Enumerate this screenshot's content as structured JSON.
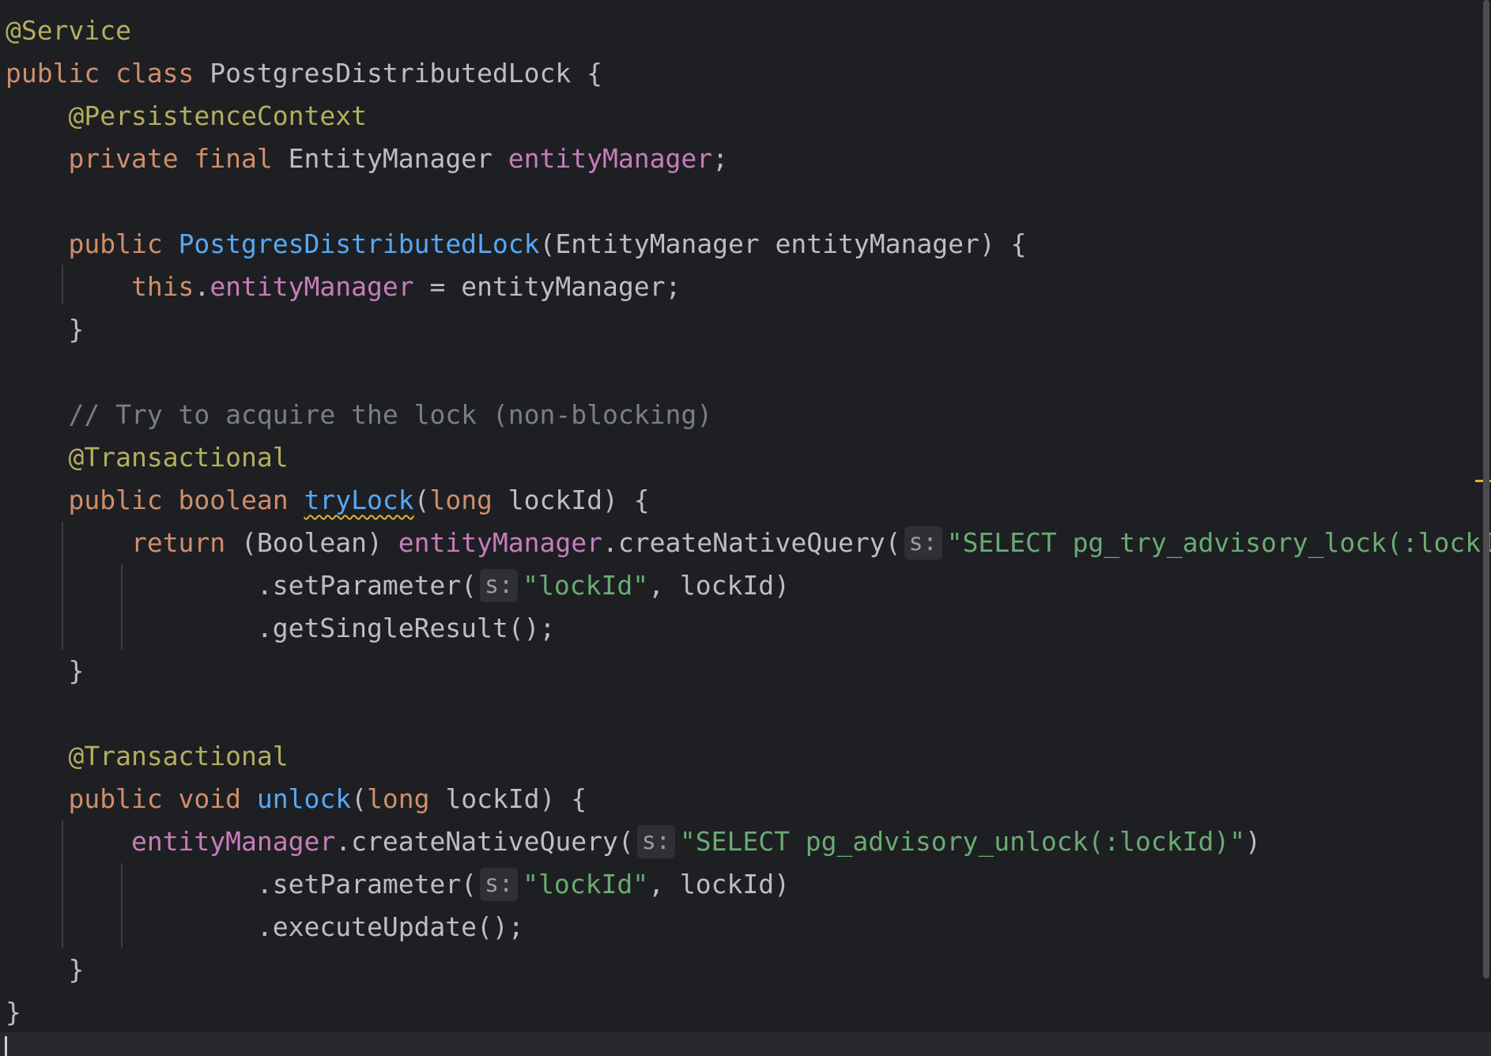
{
  "editor": {
    "language": "java",
    "colors": {
      "background": "#1e1f22",
      "annotation": "#b3ae60",
      "keyword": "#cf8e6d",
      "field": "#c77dbb",
      "method_declaration": "#56a8f5",
      "string": "#6aab73",
      "comment": "#7a7e85",
      "plain": "#bcbec4",
      "warning_underline": "#e0b23a"
    },
    "lines": [
      [
        {
          "t": "@Service",
          "c": "annotation"
        }
      ],
      [
        {
          "t": "public class ",
          "c": "keyword"
        },
        {
          "t": "PostgresDistributedLock {",
          "c": "plain"
        }
      ],
      [
        {
          "t": "    "
        },
        {
          "t": "@PersistenceContext",
          "c": "annotation"
        }
      ],
      [
        {
          "t": "    "
        },
        {
          "t": "private final ",
          "c": "keyword"
        },
        {
          "t": "EntityManager ",
          "c": "plain"
        },
        {
          "t": "entityManager",
          "c": "field"
        },
        {
          "t": ";",
          "c": "plain"
        }
      ],
      [],
      [
        {
          "t": "    "
        },
        {
          "t": "public ",
          "c": "keyword"
        },
        {
          "t": "PostgresDistributedLock",
          "c": "method-decl"
        },
        {
          "t": "(EntityManager entityManager) {",
          "c": "plain"
        }
      ],
      [
        {
          "t": "        "
        },
        {
          "t": "this",
          "c": "keyword"
        },
        {
          "t": ".",
          "c": "plain"
        },
        {
          "t": "entityManager",
          "c": "field"
        },
        {
          "t": " = entityManager;",
          "c": "plain"
        }
      ],
      [
        {
          "t": "    }",
          "c": "plain"
        }
      ],
      [],
      [
        {
          "t": "    "
        },
        {
          "t": "// Try to acquire the lock (non-blocking)",
          "c": "comment"
        }
      ],
      [
        {
          "t": "    "
        },
        {
          "t": "@Transactional",
          "c": "annotation"
        }
      ],
      [
        {
          "t": "    "
        },
        {
          "t": "public boolean ",
          "c": "keyword"
        },
        {
          "t": "tryLock",
          "c": "method-decl",
          "warn": true
        },
        {
          "t": "(",
          "c": "plain"
        },
        {
          "t": "long ",
          "c": "keyword"
        },
        {
          "t": "lockId) {",
          "c": "plain"
        }
      ],
      [
        {
          "t": "        "
        },
        {
          "t": "return ",
          "c": "keyword"
        },
        {
          "t": "(Boolean) ",
          "c": "plain"
        },
        {
          "t": "entityManager",
          "c": "field"
        },
        {
          "t": ".createNativeQuery(",
          "c": "plain"
        },
        {
          "hint": "s:"
        },
        {
          "t": "\"SELECT pg_try_advisory_lock(:lockId)\"",
          "c": "string"
        }
      ],
      [
        {
          "t": "                "
        },
        {
          "t": ".setParameter(",
          "c": "plain"
        },
        {
          "hint": "s:"
        },
        {
          "t": "\"lockId\"",
          "c": "string"
        },
        {
          "t": ", lockId)",
          "c": "plain"
        }
      ],
      [
        {
          "t": "                "
        },
        {
          "t": ".getSingleResult();",
          "c": "plain"
        }
      ],
      [
        {
          "t": "    }",
          "c": "plain"
        }
      ],
      [],
      [
        {
          "t": "    "
        },
        {
          "t": "@Transactional",
          "c": "annotation"
        }
      ],
      [
        {
          "t": "    "
        },
        {
          "t": "public void ",
          "c": "keyword"
        },
        {
          "t": "unlock",
          "c": "method-decl"
        },
        {
          "t": "(",
          "c": "plain"
        },
        {
          "t": "long ",
          "c": "keyword"
        },
        {
          "t": "lockId) {",
          "c": "plain"
        }
      ],
      [
        {
          "t": "        "
        },
        {
          "t": "entityManager",
          "c": "field"
        },
        {
          "t": ".createNativeQuery(",
          "c": "plain"
        },
        {
          "hint": "s:"
        },
        {
          "t": "\"SELECT pg_advisory_unlock(:lockId)\"",
          "c": "string"
        },
        {
          "t": ")",
          "c": "plain"
        }
      ],
      [
        {
          "t": "                "
        },
        {
          "t": ".setParameter(",
          "c": "plain"
        },
        {
          "hint": "s:"
        },
        {
          "t": "\"lockId\"",
          "c": "string"
        },
        {
          "t": ", lockId)",
          "c": "plain"
        }
      ],
      [
        {
          "t": "                "
        },
        {
          "t": ".executeUpdate();",
          "c": "plain"
        }
      ],
      [
        {
          "t": "    }",
          "c": "plain"
        }
      ],
      [
        {
          "t": "}",
          "c": "plain"
        }
      ]
    ]
  }
}
